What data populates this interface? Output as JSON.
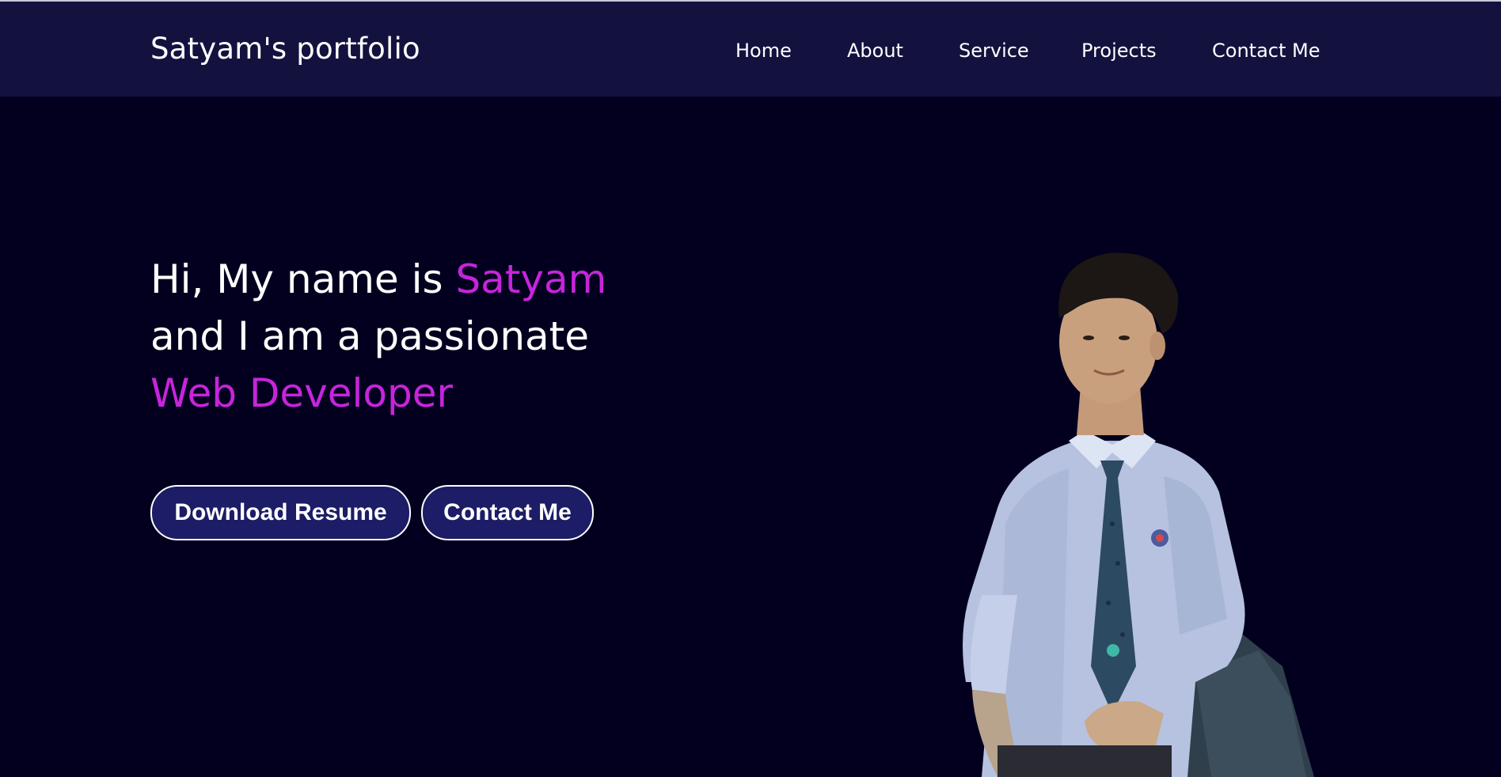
{
  "navbar": {
    "brand": "Satyam's portfolio",
    "links": [
      {
        "label": "Home"
      },
      {
        "label": "About"
      },
      {
        "label": "Service"
      },
      {
        "label": "Projects"
      },
      {
        "label": "Contact Me"
      }
    ]
  },
  "hero": {
    "line1_prefix": "Hi, My name is ",
    "line1_name": "Satyam",
    "line2": "and I am a passionate",
    "line3": "Web Developer",
    "buttons": {
      "resume": "Download Resume",
      "contact": "Contact Me"
    },
    "photo_alt": "portrait-photo"
  },
  "colors": {
    "background": "#03001f",
    "navbar": "#13123f",
    "accent": "#c724dc",
    "button_fill": "#1d1c66",
    "text": "#ffffff"
  }
}
